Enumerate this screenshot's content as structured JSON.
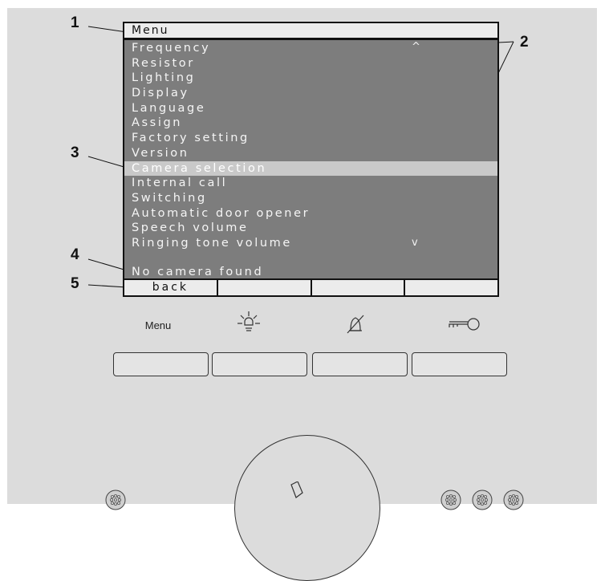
{
  "screen": {
    "title": "Menu",
    "menu_items": [
      "Frequency",
      "Resistor",
      "Lighting",
      "Display",
      "Language",
      "Assign",
      "Factory setting",
      "Version",
      "Camera selection",
      "Internal call",
      "Switching",
      "Automatic door opener",
      "Speech volume",
      "Ringing tone volume"
    ],
    "selected_item": "Camera selection",
    "scroll_up": "^",
    "scroll_down": "v",
    "status_text": "No camera found",
    "softkeys": [
      "back",
      "",
      "",
      ""
    ]
  },
  "callouts": [
    "1",
    "2",
    "3",
    "4",
    "5"
  ],
  "keys": {
    "menu_label": "Menu",
    "icons": [
      "menu-label",
      "light-icon",
      "bell-muted-icon",
      "key-icon"
    ]
  },
  "colors": {
    "panel": "#dcdcdc",
    "screen_bg": "#7d7d7d",
    "highlight": "#c9c9c9",
    "bar": "#ececec"
  }
}
